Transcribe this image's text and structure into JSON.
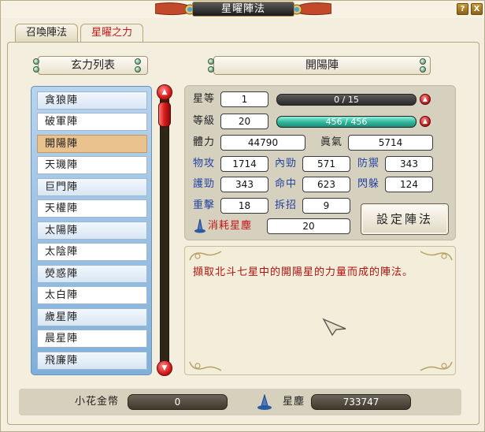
{
  "window": {
    "title": "星曜陣法",
    "help_button": "?",
    "close_button": "X"
  },
  "tabs": [
    {
      "label": "召喚陣法",
      "active": false
    },
    {
      "label": "星曜之力",
      "active": true
    }
  ],
  "list_header": "玄力列表",
  "formation_header": "開陽陣",
  "formations": [
    "貪狼陣",
    "破軍陣",
    "開陽陣",
    "天璣陣",
    "巨門陣",
    "天權陣",
    "太陽陣",
    "太陰陣",
    "熒惑陣",
    "太白陣",
    "歲星陣",
    "晨星陣",
    "飛廉陣"
  ],
  "selected_formation": "開陽陣",
  "stats": {
    "star_label": "星等",
    "star_value": "1",
    "star_progress": "0 / 15",
    "star_progress_fraction": 0,
    "level_label": "等級",
    "level_value": "20",
    "level_progress": "456 / 456",
    "level_progress_fraction": 1,
    "hp_label": "體力",
    "hp_value": "44790",
    "mp_label": "眞氣",
    "mp_value": "5714",
    "patk_label": "物攻",
    "patk_value": "1714",
    "matk_label": "內勁",
    "matk_value": "571",
    "pdef_label": "防禦",
    "pdef_value": "343",
    "mdef_label": "護勁",
    "mdef_value": "343",
    "hit_label": "命中",
    "hit_value": "623",
    "dodge_label": "閃躲",
    "dodge_value": "124",
    "crit_label": "重擊",
    "crit_value": "18",
    "parry_label": "拆招",
    "parry_value": "9",
    "cost_label": "消耗星塵",
    "cost_value": "20"
  },
  "set_button": "設定陣法",
  "description": "擷取北斗七星中的開陽星的力量而成的陣法。",
  "currency": {
    "coin_label": "小花金幣",
    "coin_value": "0",
    "dust_label": "星塵",
    "dust_value": "733747"
  },
  "colors": {
    "accent_red": "#c01818",
    "stat_blue": "#2345a0",
    "list_blue": "#7fb0dc",
    "level_bar": "#2fb59b"
  },
  "icons": [
    "help-icon",
    "close-icon",
    "scroll-up-icon",
    "scroll-down-icon",
    "upgrade-star-icon",
    "upgrade-level-icon",
    "stardust-icon",
    "mouse-cursor-icon"
  ]
}
